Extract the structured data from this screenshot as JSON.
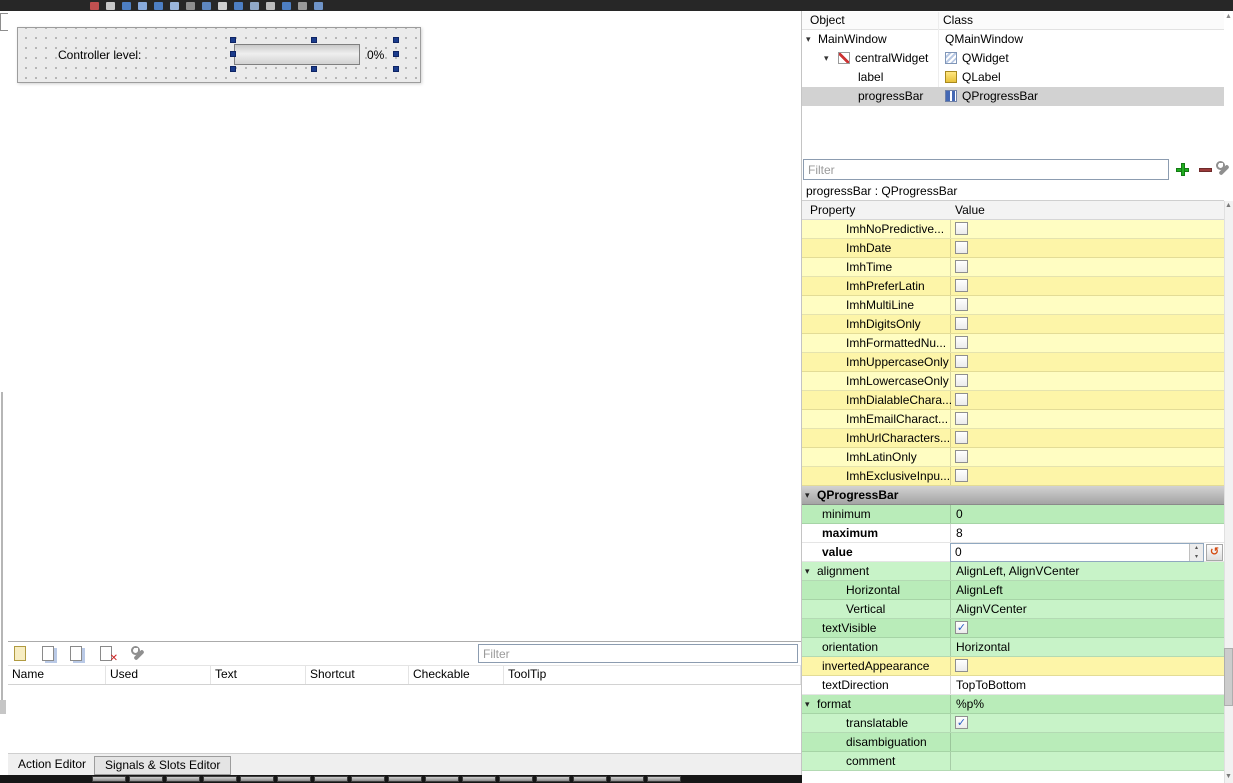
{
  "top_toolbar": {
    "icons": [
      "edit-widgets-icon",
      "save-icon",
      "cut-icon",
      "copy-icon",
      "paste-icon",
      "undo-icon",
      "redo-icon",
      "layout-horizontal-icon",
      "layout-vertical-icon",
      "layout-splitter-horizontal-icon",
      "layout-splitter-vertical-icon",
      "layout-form-icon",
      "layout-grid-icon",
      "break-layout-icon",
      "adjust-size-icon"
    ],
    "colors": {
      "toolbar_background": "#272727"
    }
  },
  "form": {
    "label": "Controller level:",
    "progress_text": "0%"
  },
  "object_inspector": {
    "columns": {
      "object": "Object",
      "class": "Class"
    },
    "rows": [
      {
        "object": "MainWindow",
        "class": "QMainWindow",
        "depth": 0,
        "expanded": true,
        "selected": false,
        "object_icon": null,
        "class_icon": null
      },
      {
        "object": "centralWidget",
        "class": "QWidget",
        "depth": 1,
        "expanded": true,
        "selected": false,
        "object_icon": "central-widget-icon",
        "class_icon": "qwidget-icon"
      },
      {
        "object": "label",
        "class": "QLabel",
        "depth": 2,
        "expanded": false,
        "selected": false,
        "object_icon": null,
        "class_icon": "qlabel-icon"
      },
      {
        "object": "progressBar",
        "class": "QProgressBar",
        "depth": 2,
        "expanded": false,
        "selected": true,
        "object_icon": null,
        "class_icon": "qprogressbar-icon"
      }
    ]
  },
  "property_panel": {
    "filter_placeholder": "Filter",
    "object_label": "progressBar : QProgressBar",
    "columns": {
      "property": "Property",
      "value": "Value"
    },
    "colors": {
      "unset_row": "#fffdc2",
      "set_row": "#c8f3c8",
      "group_row": "#a4a4a4"
    },
    "rows": [
      {
        "name": "ImhNoPredictive...",
        "value": "",
        "tone": "yellow",
        "indent": 2,
        "control": "checkbox",
        "expander": false,
        "bold": false
      },
      {
        "name": "ImhDate",
        "value": "",
        "tone": "yellow",
        "indent": 2,
        "control": "checkbox",
        "expander": false,
        "bold": false
      },
      {
        "name": "ImhTime",
        "value": "",
        "tone": "yellow",
        "indent": 2,
        "control": "checkbox",
        "expander": false,
        "bold": false
      },
      {
        "name": "ImhPreferLatin",
        "value": "",
        "tone": "yellow",
        "indent": 2,
        "control": "checkbox",
        "expander": false,
        "bold": false
      },
      {
        "name": "ImhMultiLine",
        "value": "",
        "tone": "yellow",
        "indent": 2,
        "control": "checkbox",
        "expander": false,
        "bold": false
      },
      {
        "name": "ImhDigitsOnly",
        "value": "",
        "tone": "yellow",
        "indent": 2,
        "control": "checkbox",
        "expander": false,
        "bold": false
      },
      {
        "name": "ImhFormattedNu...",
        "value": "",
        "tone": "yellow",
        "indent": 2,
        "control": "checkbox",
        "expander": false,
        "bold": false
      },
      {
        "name": "ImhUppercaseOnly",
        "value": "",
        "tone": "yellow",
        "indent": 2,
        "control": "checkbox",
        "expander": false,
        "bold": false
      },
      {
        "name": "ImhLowercaseOnly",
        "value": "",
        "tone": "yellow",
        "indent": 2,
        "control": "checkbox",
        "expander": false,
        "bold": false
      },
      {
        "name": "ImhDialableChara...",
        "value": "",
        "tone": "yellow",
        "indent": 2,
        "control": "checkbox",
        "expander": false,
        "bold": false
      },
      {
        "name": "ImhEmailCharact...",
        "value": "",
        "tone": "yellow",
        "indent": 2,
        "control": "checkbox",
        "expander": false,
        "bold": false
      },
      {
        "name": "ImhUrlCharacters...",
        "value": "",
        "tone": "yellow",
        "indent": 2,
        "control": "checkbox",
        "expander": false,
        "bold": false
      },
      {
        "name": "ImhLatinOnly",
        "value": "",
        "tone": "yellow",
        "indent": 2,
        "control": "checkbox",
        "expander": false,
        "bold": false
      },
      {
        "name": "ImhExclusiveInpu...",
        "value": "",
        "tone": "yellow",
        "indent": 2,
        "control": "checkbox",
        "expander": false,
        "bold": false
      },
      {
        "name": "QProgressBar",
        "value": "",
        "tone": "group",
        "indent": 0,
        "control": "none",
        "expander": true,
        "bold": true
      },
      {
        "name": "minimum",
        "value": "0",
        "tone": "green",
        "indent": 1,
        "control": "text",
        "expander": false,
        "bold": false
      },
      {
        "name": "maximum",
        "value": "8",
        "tone": "white",
        "indent": 1,
        "control": "text",
        "expander": false,
        "bold": true
      },
      {
        "name": "value",
        "value": "0",
        "tone": "white",
        "indent": 1,
        "control": "spinbox",
        "expander": false,
        "bold": true
      },
      {
        "name": "alignment",
        "value": "AlignLeft, AlignVCenter",
        "tone": "green",
        "indent": 0,
        "control": "text",
        "expander": true,
        "bold": false
      },
      {
        "name": "Horizontal",
        "value": "AlignLeft",
        "tone": "green",
        "indent": 2,
        "control": "text",
        "expander": false,
        "bold": false
      },
      {
        "name": "Vertical",
        "value": "AlignVCenter",
        "tone": "green",
        "indent": 2,
        "control": "text",
        "expander": false,
        "bold": false
      },
      {
        "name": "textVisible",
        "value": "",
        "tone": "green",
        "indent": 1,
        "control": "checkbox-checked",
        "expander": false,
        "bold": false
      },
      {
        "name": "orientation",
        "value": "Horizontal",
        "tone": "green",
        "indent": 1,
        "control": "text",
        "expander": false,
        "bold": false
      },
      {
        "name": "invertedAppearance",
        "value": "",
        "tone": "yellow",
        "indent": 1,
        "control": "checkbox",
        "expander": false,
        "bold": false
      },
      {
        "name": "textDirection",
        "value": "TopToBottom",
        "tone": "white",
        "indent": 1,
        "control": "text",
        "expander": false,
        "bold": false
      },
      {
        "name": "format",
        "value": "%p%",
        "tone": "green",
        "indent": 0,
        "control": "text",
        "expander": true,
        "bold": false
      },
      {
        "name": "translatable",
        "value": "",
        "tone": "green",
        "indent": 2,
        "control": "checkbox-checked",
        "expander": false,
        "bold": false
      },
      {
        "name": "disambiguation",
        "value": "",
        "tone": "green",
        "indent": 2,
        "control": "text",
        "expander": false,
        "bold": false
      },
      {
        "name": "comment",
        "value": "",
        "tone": "green",
        "indent": 2,
        "control": "text",
        "expander": false,
        "bold": false
      }
    ]
  },
  "action_editor": {
    "toolbar_icons": [
      "new-action-icon",
      "copy-action-icon",
      "paste-action-icon",
      "delete-action-icon",
      "configure-action-editor-icon"
    ],
    "filter_placeholder": "Filter",
    "columns": [
      "Name",
      "Used",
      "Text",
      "Shortcut",
      "Checkable",
      "ToolTip"
    ],
    "tabs": [
      {
        "label": "Action Editor",
        "active": true
      },
      {
        "label": "Signals & Slots Editor",
        "active": false
      }
    ]
  },
  "taskbar": {
    "window_count": 16
  }
}
